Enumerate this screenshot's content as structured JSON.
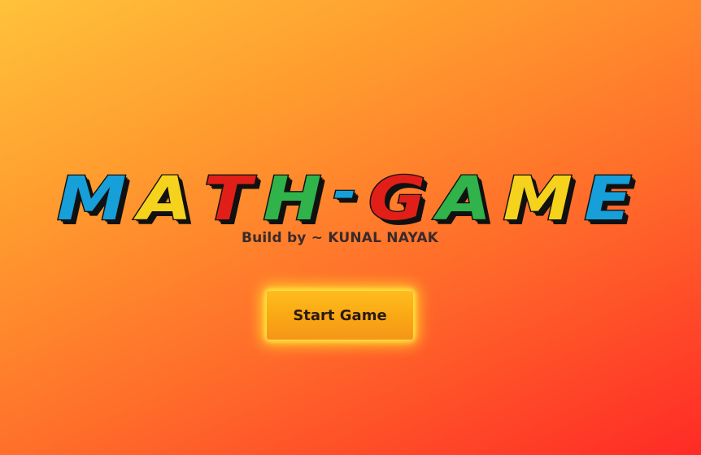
{
  "title": {
    "letters": [
      {
        "char": "M",
        "color": "#169fd9"
      },
      {
        "char": "A",
        "color": "#f5d21c"
      },
      {
        "char": "T",
        "color": "#e11f18"
      },
      {
        "char": "H",
        "color": "#2fb34a"
      },
      {
        "char": "-",
        "color": "#169fd9"
      },
      {
        "char": "G",
        "color": "#e11f18"
      },
      {
        "char": "A",
        "color": "#2fb34a"
      },
      {
        "char": "M",
        "color": "#f5d21c"
      },
      {
        "char": "E",
        "color": "#169fd9"
      }
    ]
  },
  "byline": "Build by ~ KUNAL NAYAK",
  "start_button": {
    "label": "Start Game"
  },
  "colors": {
    "background_top_left": "#ffc23a",
    "background_bottom_right": "#ff2a26",
    "button": "#f9a714",
    "button_glow": "#ffec28"
  }
}
